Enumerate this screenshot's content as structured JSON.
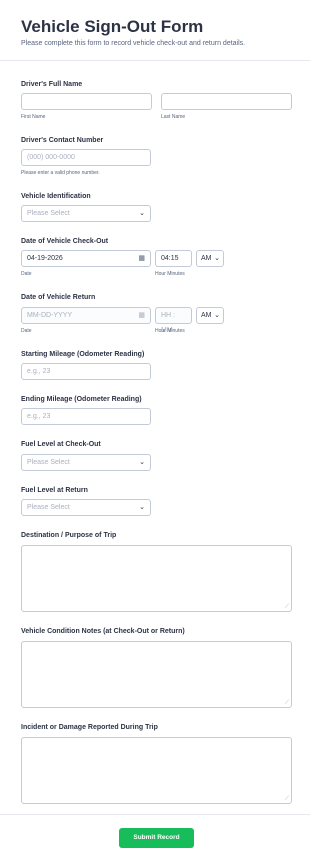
{
  "form": {
    "title": "Vehicle Sign-Out Form",
    "subtitle": "Please complete this form to record vehicle check-out and return details."
  },
  "driver_name": {
    "label": "Driver's Full Name",
    "first_sub": "First Name",
    "last_sub": "Last Name"
  },
  "contact": {
    "label": "Driver's Contact Number",
    "placeholder": "(000) 000-0000",
    "hint": "Please enter a valid phone number."
  },
  "vehicle_id": {
    "label": "Vehicle Identification",
    "placeholder": "Please Select"
  },
  "checkout": {
    "label": "Date of Vehicle Check-Out",
    "date": "04-19-2026",
    "time": "04:15",
    "ampm": "AM",
    "date_sub": "Date",
    "time_sub": "Hour Minutes"
  },
  "return_date": {
    "label": "Date of Vehicle Return",
    "date_placeholder": "MM-DD-YYYY",
    "time_placeholder": "HH : MM",
    "ampm": "AM",
    "date_sub": "Date",
    "time_sub": "Hour Minutes"
  },
  "start_mileage": {
    "label": "Starting Mileage (Odometer Reading)",
    "placeholder": "e.g., 23"
  },
  "end_mileage": {
    "label": "Ending Mileage (Odometer Reading)",
    "placeholder": "e.g., 23"
  },
  "fuel_out": {
    "label": "Fuel Level at Check-Out",
    "placeholder": "Please Select"
  },
  "fuel_return": {
    "label": "Fuel Level at Return",
    "placeholder": "Please Select"
  },
  "destination": {
    "label": "Destination / Purpose of Trip"
  },
  "condition": {
    "label": "Vehicle Condition Notes (at Check-Out or Return)"
  },
  "incident": {
    "label": "Incident or Damage Reported During Trip"
  },
  "submit_label": "Submit Record",
  "icons": {
    "chevron": "chevron-down-icon",
    "calendar": "calendar-icon",
    "resize": "resize-grip-icon"
  }
}
